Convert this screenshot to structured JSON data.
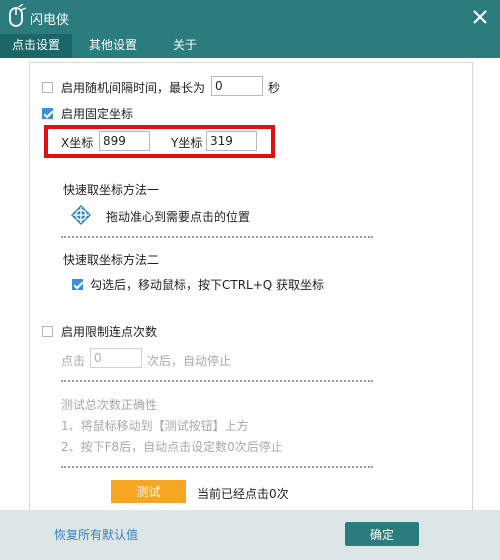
{
  "window": {
    "title": "闪电侠",
    "close_icon": "close-icon",
    "app_icon": "mouse-icon"
  },
  "tabs": [
    {
      "label": "点击设置",
      "active": true
    },
    {
      "label": "其他设置",
      "active": false
    },
    {
      "label": "关于",
      "active": false
    }
  ],
  "random_interval": {
    "checked": false,
    "label": "启用随机间隔时间，最长为",
    "value": "0",
    "unit": "秒"
  },
  "fixed_coord": {
    "checked": true,
    "label": "启用固定坐标",
    "x_label": "X坐标",
    "x_value": "899",
    "y_label": "Y坐标",
    "y_value": "319",
    "highlight_color": "#e01010"
  },
  "method1": {
    "title": "快速取坐标方法一",
    "icon": "crosshair-icon",
    "text": "拖动准心到需要点击的位置"
  },
  "method2": {
    "title": "快速取坐标方法二",
    "checked": true,
    "text": "勾选后，移动鼠标，按下CTRL+Q 获取坐标"
  },
  "limit_clicks": {
    "checked": false,
    "label": "启用限制连点次数",
    "prefix": "点击",
    "value": "0",
    "suffix": "次后，自动停止"
  },
  "test_section": {
    "title": "测试总次数正确性",
    "step1": "1、将鼠标移动到【测试按钮】上方",
    "step2": "2、按下F8后，自动点击设定数0次后停止",
    "button": "测试",
    "status": "当前已经点击0次"
  },
  "footer": {
    "restore": "恢复所有默认值",
    "ok": "确定"
  },
  "colors": {
    "title_bar": "#2b7d7d",
    "accent": "#f5a623",
    "link": "#3a7fc8",
    "checkbox": "#3a8fd6"
  }
}
